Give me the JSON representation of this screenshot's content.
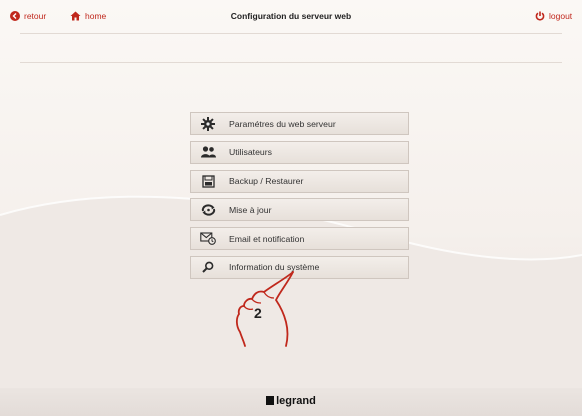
{
  "header": {
    "back_label": "retour",
    "home_label": "home",
    "title": "Configuration du serveur web",
    "logout_label": "logout"
  },
  "menu": {
    "items": [
      {
        "label": "Paramétres du web serveur",
        "icon": "gear-icon"
      },
      {
        "label": "Utilisateurs",
        "icon": "users-icon"
      },
      {
        "label": "Backup / Restaurer",
        "icon": "backup-icon"
      },
      {
        "label": "Mise à jour",
        "icon": "update-icon"
      },
      {
        "label": "Email et notification",
        "icon": "email-icon"
      },
      {
        "label": "Information du système",
        "icon": "search-icon"
      }
    ]
  },
  "annotation": {
    "step_number": "2"
  },
  "footer": {
    "brand": "legrand"
  },
  "colors": {
    "accent": "#c0281c",
    "icon": "#2b2b2b"
  }
}
